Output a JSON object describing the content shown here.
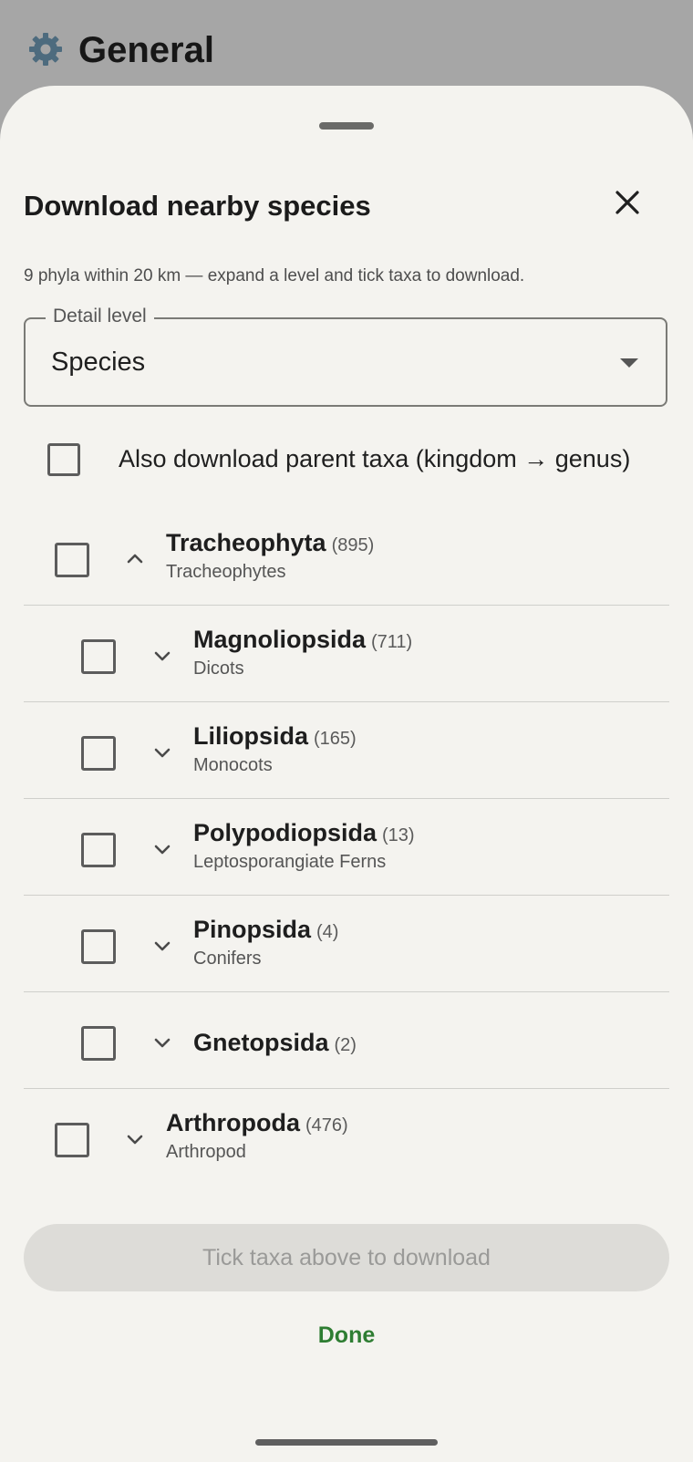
{
  "background_screen": {
    "title": "General",
    "icon": "gear-icon"
  },
  "sheet": {
    "title": "Download nearby species",
    "close_icon": "close-icon",
    "subtitle": "9 phyla within 20 km — expand a level and tick taxa to download.",
    "detail_level": {
      "label": "Detail level",
      "value": "Species"
    },
    "parent_taxa": {
      "label": "Also download parent taxa (kingdom → genus)",
      "checked": false
    },
    "taxa": [
      {
        "name": "Tracheophyta",
        "count": "(895)",
        "common": "Tracheophytes",
        "expanded": true,
        "checked": false
      },
      {
        "name": "Magnoliopsida",
        "count": "(711)",
        "common": "Dicots",
        "expanded": false,
        "checked": false
      },
      {
        "name": "Liliopsida",
        "count": "(165)",
        "common": "Monocots",
        "expanded": false,
        "checked": false
      },
      {
        "name": "Polypodiopsida",
        "count": "(13)",
        "common": "Leptosporangiate Ferns",
        "expanded": false,
        "checked": false
      },
      {
        "name": "Pinopsida",
        "count": "(4)",
        "common": "Conifers",
        "expanded": false,
        "checked": false
      },
      {
        "name": "Gnetopsida",
        "count": "(2)",
        "common": "",
        "expanded": false,
        "checked": false
      },
      {
        "name": "Arthropoda",
        "count": "(476)",
        "common": "Arthropod",
        "expanded": false,
        "checked": false
      }
    ],
    "download_button": "Tick taxa above to download",
    "done_button": "Done"
  },
  "colors": {
    "accent": "#2e7d32",
    "sheet_bg": "#f4f3ef",
    "scrim": "#a6a6a6"
  }
}
